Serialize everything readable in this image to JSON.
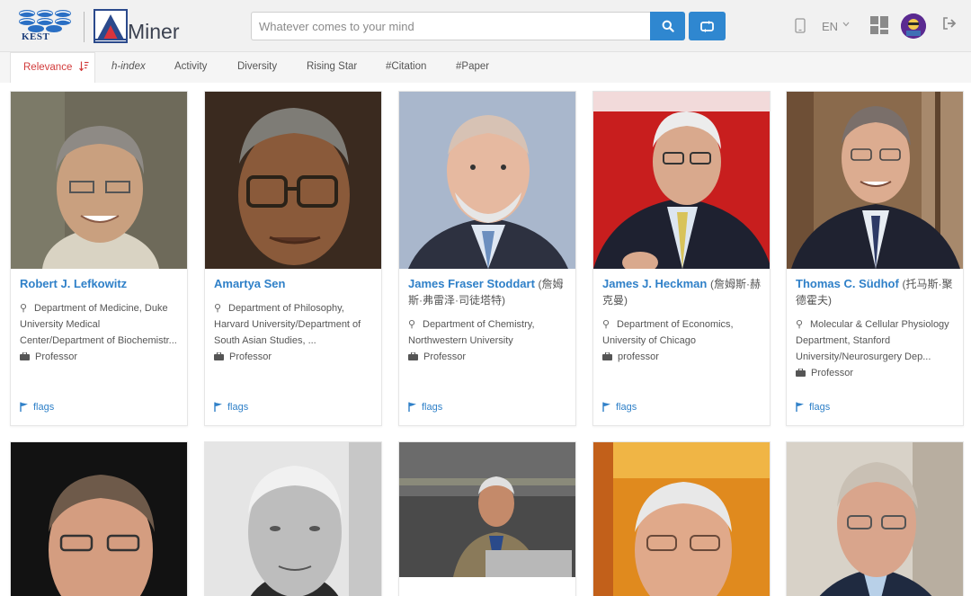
{
  "header": {
    "kest_logo_text": "KEST",
    "aminer_logo_text": "Miner",
    "search_placeholder": "Whatever comes to your mind",
    "language": "EN"
  },
  "tabs": [
    {
      "label": "Relevance",
      "active": true
    },
    {
      "label": "h-index",
      "active": false
    },
    {
      "label": "Activity",
      "active": false
    },
    {
      "label": "Diversity",
      "active": false
    },
    {
      "label": "Rising Star",
      "active": false
    },
    {
      "label": "#Citation",
      "active": false
    },
    {
      "label": "#Paper",
      "active": false
    }
  ],
  "scholars": [
    {
      "name": "Robert J. Lefkowitz",
      "name_cn": "",
      "affiliation": "Department of Medicine, Duke University Medical Center/Department of Biochemistr...",
      "position": "Professor",
      "flags": "flags"
    },
    {
      "name": "Amartya Sen",
      "name_cn": "",
      "affiliation": "Department of Philosophy, Harvard University/Department of South Asian Studies, ...",
      "position": "Professor",
      "flags": "flags"
    },
    {
      "name": "James Fraser Stoddart",
      "name_cn": "(詹姆斯·弗雷泽·司徒塔特)",
      "affiliation": "Department of Chemistry, Northwestern University",
      "position": "Professor",
      "flags": "flags"
    },
    {
      "name": "James J. Heckman",
      "name_cn": "(詹姆斯·赫克曼)",
      "affiliation": "Department of Economics, University of Chicago",
      "position": "professor",
      "flags": "flags"
    },
    {
      "name": "Thomas C. Südhof",
      "name_cn": "(托马斯·聚德霍夫)",
      "affiliation": "Molecular & Cellular Physiology Department, Stanford University/Neurosurgery Dep...",
      "position": "Professor",
      "flags": "flags"
    }
  ],
  "colors": {
    "accent": "#2f87d0",
    "active_tab": "#d23b3b",
    "link": "#2f80c8"
  }
}
